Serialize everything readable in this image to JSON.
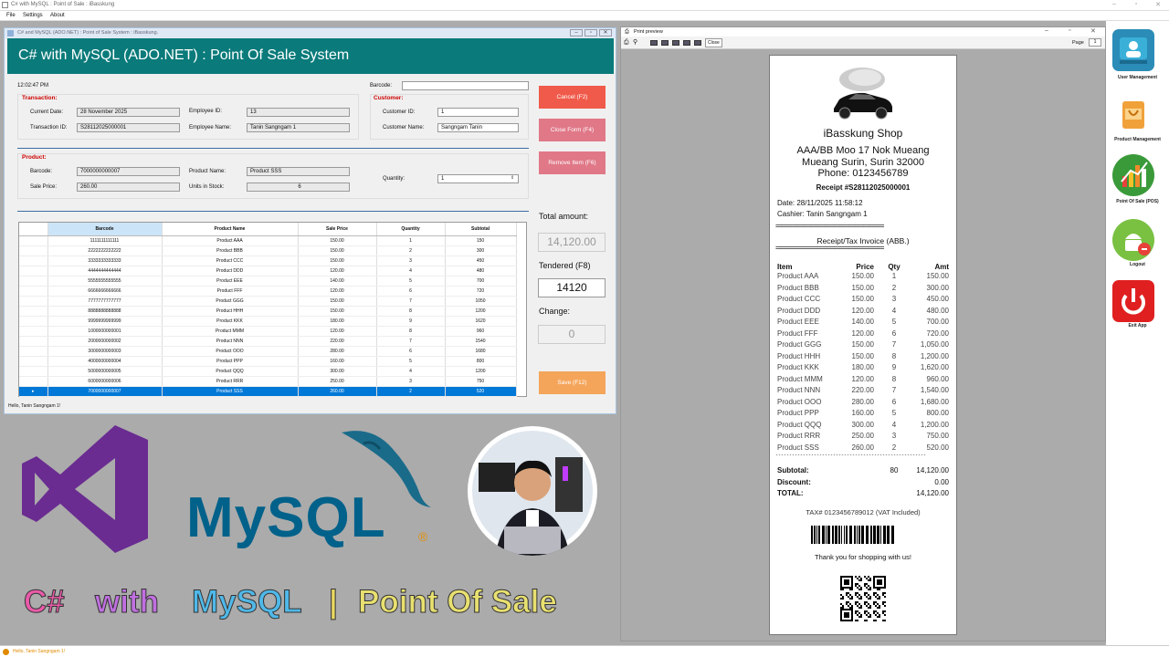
{
  "window": {
    "title": "C# with MySQL : Point of Sale : iBasskung"
  },
  "menu": [
    "File",
    "Settings",
    "About"
  ],
  "form": {
    "title": "C# and MySQL (ADO.NET) : Point of Sale System : iBasskung.",
    "header": "C# with MySQL (ADO.NET) : Point Of Sale System",
    "time": "12:02:47 PM",
    "barcode_label": "Barcode:",
    "barcode_value": "",
    "transaction": {
      "section": "Transaction:",
      "current_date_label": "Current Date:",
      "current_date": "28 November 2025",
      "transaction_id_label": "Transaction ID:",
      "transaction_id": "S28112025000001",
      "employee_id_label": "Employee ID:",
      "employee_id": "13",
      "employee_name_label": "Employee Name:",
      "employee_name": "Tanin Sangngam 1"
    },
    "customer": {
      "section": "Customer:",
      "customer_id_label": "Customer ID:",
      "customer_id": "1",
      "customer_name_label": "Customer Name:",
      "customer_name": "Sangngam Tanin"
    },
    "product": {
      "section": "Product:",
      "barcode_label": "Barcode:",
      "barcode": "7000000000007",
      "product_name_label": "Product Name:",
      "product_name": "Product SSS",
      "sale_price_label": "Sale Price:",
      "sale_price": "260.00",
      "units_label": "Units in Stock:",
      "units": "6",
      "quantity_label": "Quantity:",
      "quantity": "1"
    },
    "buttons": {
      "cancel": "Cancel (F2)",
      "close": "Close Form (F4)",
      "remove": "Remove Item (F6)",
      "save": "Save (F12)"
    },
    "colors": {
      "cancel": "#f05a4a",
      "close": "#e07888",
      "remove": "#e07888",
      "save": "#f5a55a",
      "header": "#0a7a7a"
    },
    "total_label": "Total amount:",
    "total": "14,120.00",
    "tendered_label": "Tendered (F8)",
    "tendered": "14120",
    "change_label": "Change:",
    "change": "0",
    "grid": {
      "columns": [
        "Barcode",
        "Product Name",
        "Sale Price",
        "Quantity",
        "Subtotal"
      ],
      "rows": [
        [
          "1111111111111",
          "Product AAA",
          "150.00",
          "1",
          "150"
        ],
        [
          "2222222222222",
          "Product BBB",
          "150.00",
          "2",
          "300"
        ],
        [
          "3333333333333",
          "Product CCC",
          "150.00",
          "3",
          "450"
        ],
        [
          "4444444444444",
          "Product DDD",
          "120.00",
          "4",
          "480"
        ],
        [
          "5555555555555",
          "Product EEE",
          "140.00",
          "5",
          "700"
        ],
        [
          "6666666666666",
          "Product FFF",
          "120.00",
          "6",
          "720"
        ],
        [
          "7777777777777",
          "Product GGG",
          "150.00",
          "7",
          "1050"
        ],
        [
          "8888888888888",
          "Product HHH",
          "150.00",
          "8",
          "1200"
        ],
        [
          "9999999999999",
          "Product KKK",
          "180.00",
          "9",
          "1620"
        ],
        [
          "1000000000001",
          "Product MMM",
          "120.00",
          "8",
          "960"
        ],
        [
          "2000000000002",
          "Product NNN",
          "220.00",
          "7",
          "1540"
        ],
        [
          "3000000000003",
          "Product OOO",
          "280.00",
          "6",
          "1680"
        ],
        [
          "4000000000004",
          "Product PPP",
          "160.00",
          "5",
          "800"
        ],
        [
          "5000000000005",
          "Product QQQ",
          "300.00",
          "4",
          "1200"
        ],
        [
          "6000000000006",
          "Product RRR",
          "250.00",
          "3",
          "750"
        ],
        [
          "7000000000007",
          "Product SSS",
          "260.00",
          "2",
          "520"
        ]
      ]
    },
    "status": "Hello, Tanin Sangngam 1!"
  },
  "preview": {
    "title": "Print preview",
    "close": "Close",
    "page_label": "Page",
    "page": "1",
    "receipt": {
      "shop": "iBasskung Shop",
      "address1": "AAA/BB Moo 17 Nok Mueang",
      "address2": "Mueang Surin, Surin 32000",
      "phone": "Phone: 0123456789",
      "receipt_no": "Receipt #S28112025000001",
      "date": "Date: 28/11/2025 11:58:12",
      "cashier": "Cashier: Tanin Sangngam 1",
      "separator": "=====================================",
      "invoice": "Receipt/Tax Invoice (ABB.)",
      "col_item": "Item",
      "col_price": "Price",
      "col_qty": "Qty",
      "col_amt": "Amt",
      "items": [
        [
          "Product AAA",
          "150.00",
          "1",
          "150.00"
        ],
        [
          "Product BBB",
          "150.00",
          "2",
          "300.00"
        ],
        [
          "Product CCC",
          "150.00",
          "3",
          "450.00"
        ],
        [
          "Product DDD",
          "120.00",
          "4",
          "480.00"
        ],
        [
          "Product EEE",
          "140.00",
          "5",
          "700.00"
        ],
        [
          "Product FFF",
          "120.00",
          "6",
          "720.00"
        ],
        [
          "Product GGG",
          "150.00",
          "7",
          "1,050.00"
        ],
        [
          "Product HHH",
          "150.00",
          "8",
          "1,200.00"
        ],
        [
          "Product KKK",
          "180.00",
          "9",
          "1,620.00"
        ],
        [
          "Product MMM",
          "120.00",
          "8",
          "960.00"
        ],
        [
          "Product NNN",
          "220.00",
          "7",
          "1,540.00"
        ],
        [
          "Product OOO",
          "280.00",
          "6",
          "1,680.00"
        ],
        [
          "Product PPP",
          "160.00",
          "5",
          "800.00"
        ],
        [
          "Product QQQ",
          "300.00",
          "4",
          "1,200.00"
        ],
        [
          "Product RRR",
          "250.00",
          "3",
          "750.00"
        ],
        [
          "Product SSS",
          "260.00",
          "2",
          "520.00"
        ]
      ],
      "dashes": "-------------------------------------------------------",
      "subtotal_label": "Subtotal:",
      "subtotal_qty": "80",
      "subtotal": "14,120.00",
      "discount_label": "Discount:",
      "discount": "0.00",
      "total_label": "TOTAL:",
      "total": "14,120.00",
      "tax": "TAX# 0123456789012 (VAT Included)",
      "thanks": "Thank you for shopping with us!"
    }
  },
  "launcher": [
    {
      "label": "User Management",
      "icon": "user-management-icon"
    },
    {
      "label": "Product Management",
      "icon": "product-management-icon"
    },
    {
      "label": "Point Of Sale (POS)",
      "icon": "pos-chart-icon"
    },
    {
      "label": "Logout",
      "icon": "android-logout-icon"
    },
    {
      "label": "Exit App",
      "icon": "power-icon"
    }
  ],
  "logos": {
    "mysql": "MySQL"
  },
  "banner": {
    "cs": "C#",
    "with": "with",
    "mysql": "MySQL",
    "bar": "|",
    "pos": "Point Of Sale"
  },
  "status_bottom": "Hello, Tanin Sangngam 1!"
}
